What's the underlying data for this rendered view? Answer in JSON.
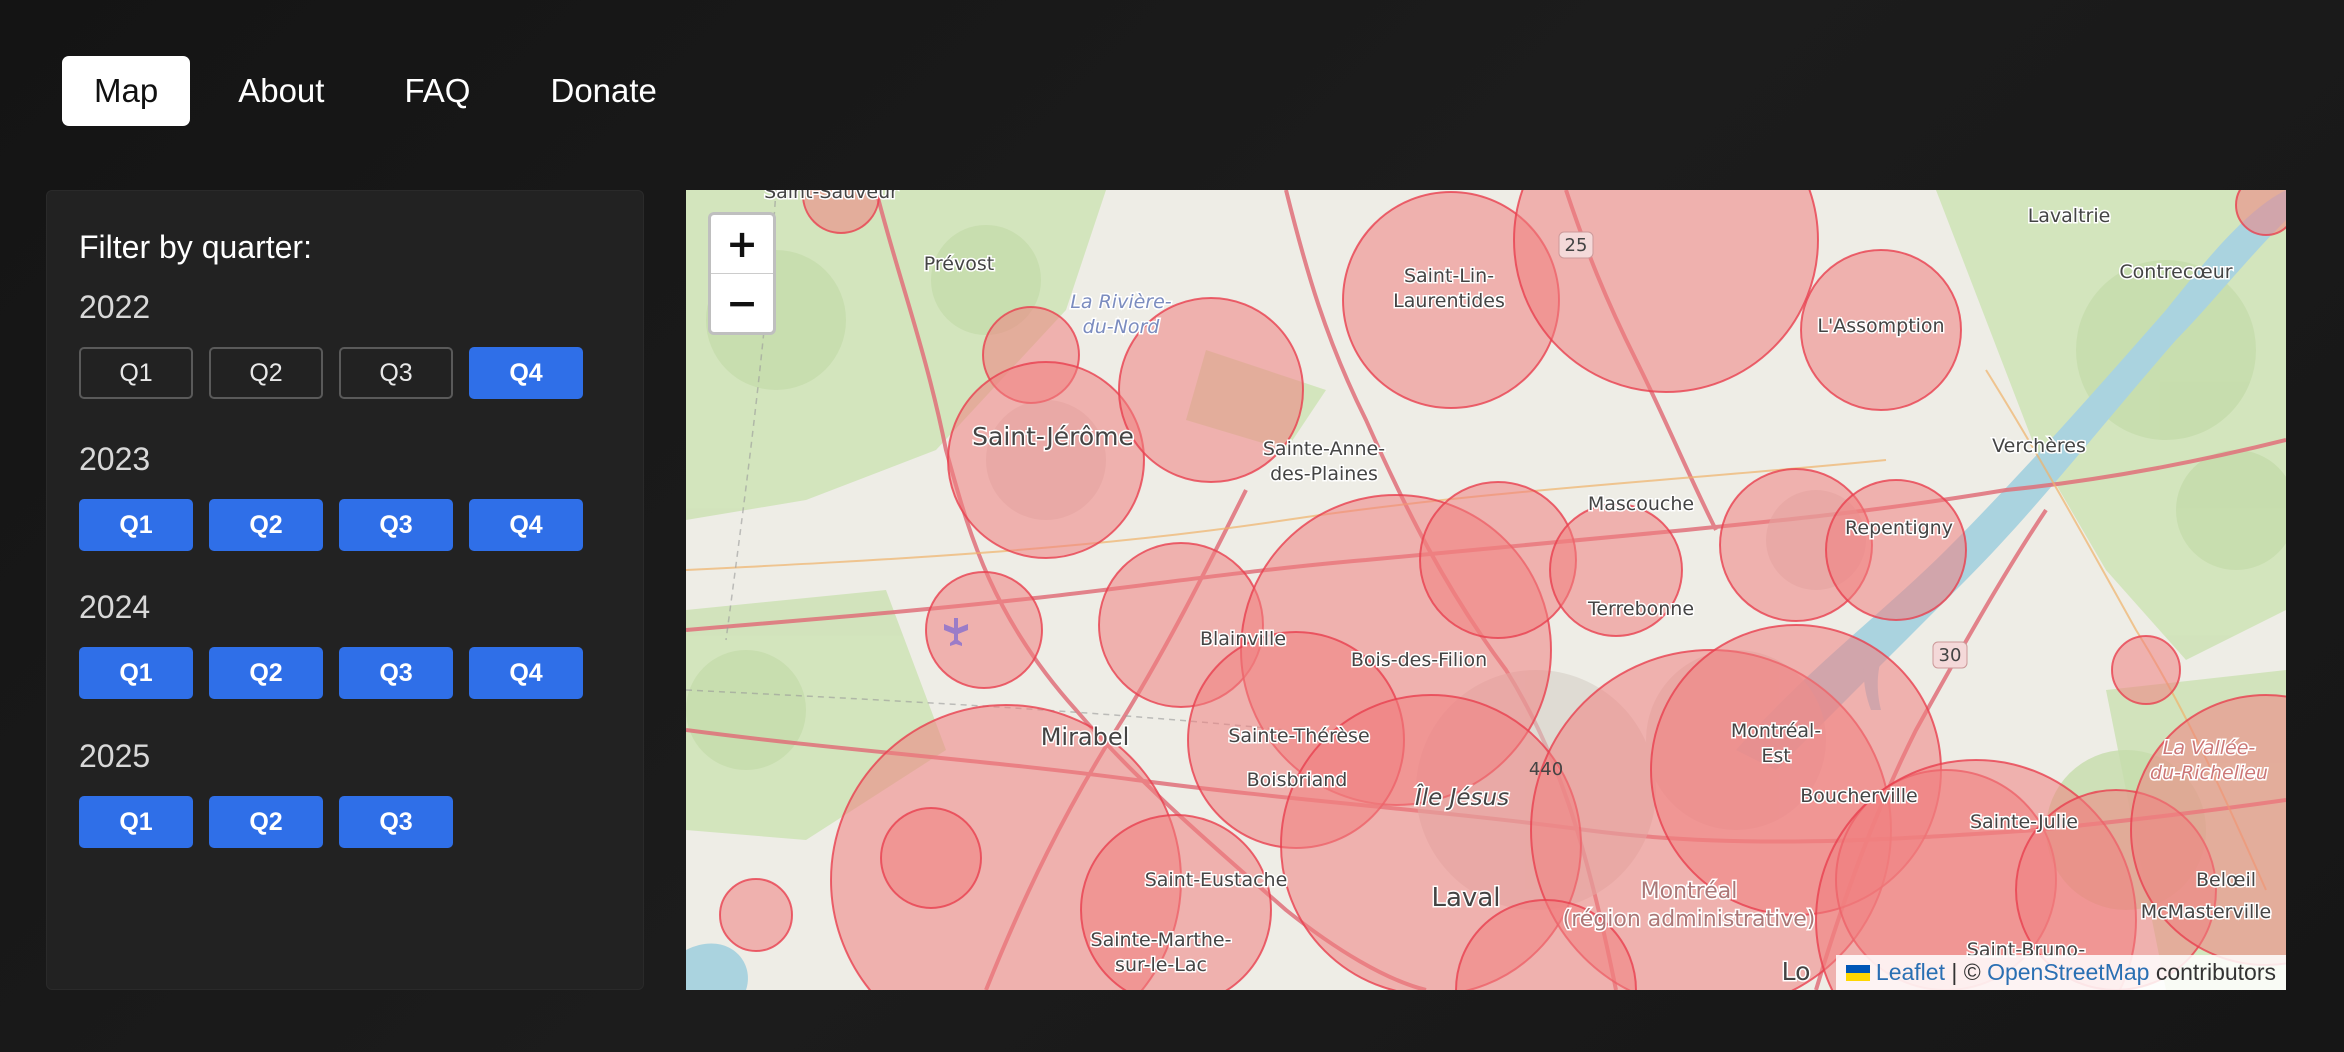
{
  "nav": [
    {
      "label": "Map",
      "active": true
    },
    {
      "label": "About",
      "active": false
    },
    {
      "label": "FAQ",
      "active": false
    },
    {
      "label": "Donate",
      "active": false
    }
  ],
  "filter": {
    "title": "Filter by quarter:",
    "years": [
      {
        "year": "2022",
        "quarters": [
          {
            "label": "Q1",
            "selected": false
          },
          {
            "label": "Q2",
            "selected": false
          },
          {
            "label": "Q3",
            "selected": false
          },
          {
            "label": "Q4",
            "selected": true
          }
        ]
      },
      {
        "year": "2023",
        "quarters": [
          {
            "label": "Q1",
            "selected": true
          },
          {
            "label": "Q2",
            "selected": true
          },
          {
            "label": "Q3",
            "selected": true
          },
          {
            "label": "Q4",
            "selected": true
          }
        ]
      },
      {
        "year": "2024",
        "quarters": [
          {
            "label": "Q1",
            "selected": true
          },
          {
            "label": "Q2",
            "selected": true
          },
          {
            "label": "Q3",
            "selected": true
          },
          {
            "label": "Q4",
            "selected": true
          }
        ]
      },
      {
        "year": "2025",
        "quarters": [
          {
            "label": "Q1",
            "selected": true
          },
          {
            "label": "Q2",
            "selected": true
          },
          {
            "label": "Q3",
            "selected": true
          }
        ]
      }
    ]
  },
  "map": {
    "zoom_in": "+",
    "zoom_out": "−",
    "attribution": {
      "leaflet": "Leaflet",
      "sep": " | © ",
      "osm": "OpenStreetMap",
      "suffix": " contributors"
    },
    "labels": [
      "Saint-Sauveur",
      "Prévost",
      "La Rivière-",
      "du-Nord",
      "Saint-Jérôme",
      "Saint-Lin-",
      "Laurentides",
      "Sainte-Anne-",
      "des-Plaines",
      "Mascouche",
      "L'Assomption",
      "Lavaltrie",
      "Contrecœur",
      "Verchères",
      "Repentigny",
      "Terrebonne",
      "Blainville",
      "Bois-des-Filion",
      "Mirabel",
      "Sainte-Thérèse",
      "Boisbriand",
      "Île Jésus",
      "Montréal-",
      "Est",
      "Boucherville",
      "Saint-Eustache",
      "Sainte-Marthe-",
      "sur-le-Lac",
      "Laval",
      "Montréal",
      "(région administrative)",
      "Sainte-Julie",
      "La Vallée-",
      "du-Richelieu",
      "Belœil",
      "McMasterville",
      "Saint-Bruno-",
      "Lo",
      "25",
      "30",
      "440"
    ],
    "colors": {
      "circle_fill": "#f08080",
      "circle_stroke": "#e8404f",
      "road": "#e0707a",
      "water": "#aad3df"
    }
  }
}
